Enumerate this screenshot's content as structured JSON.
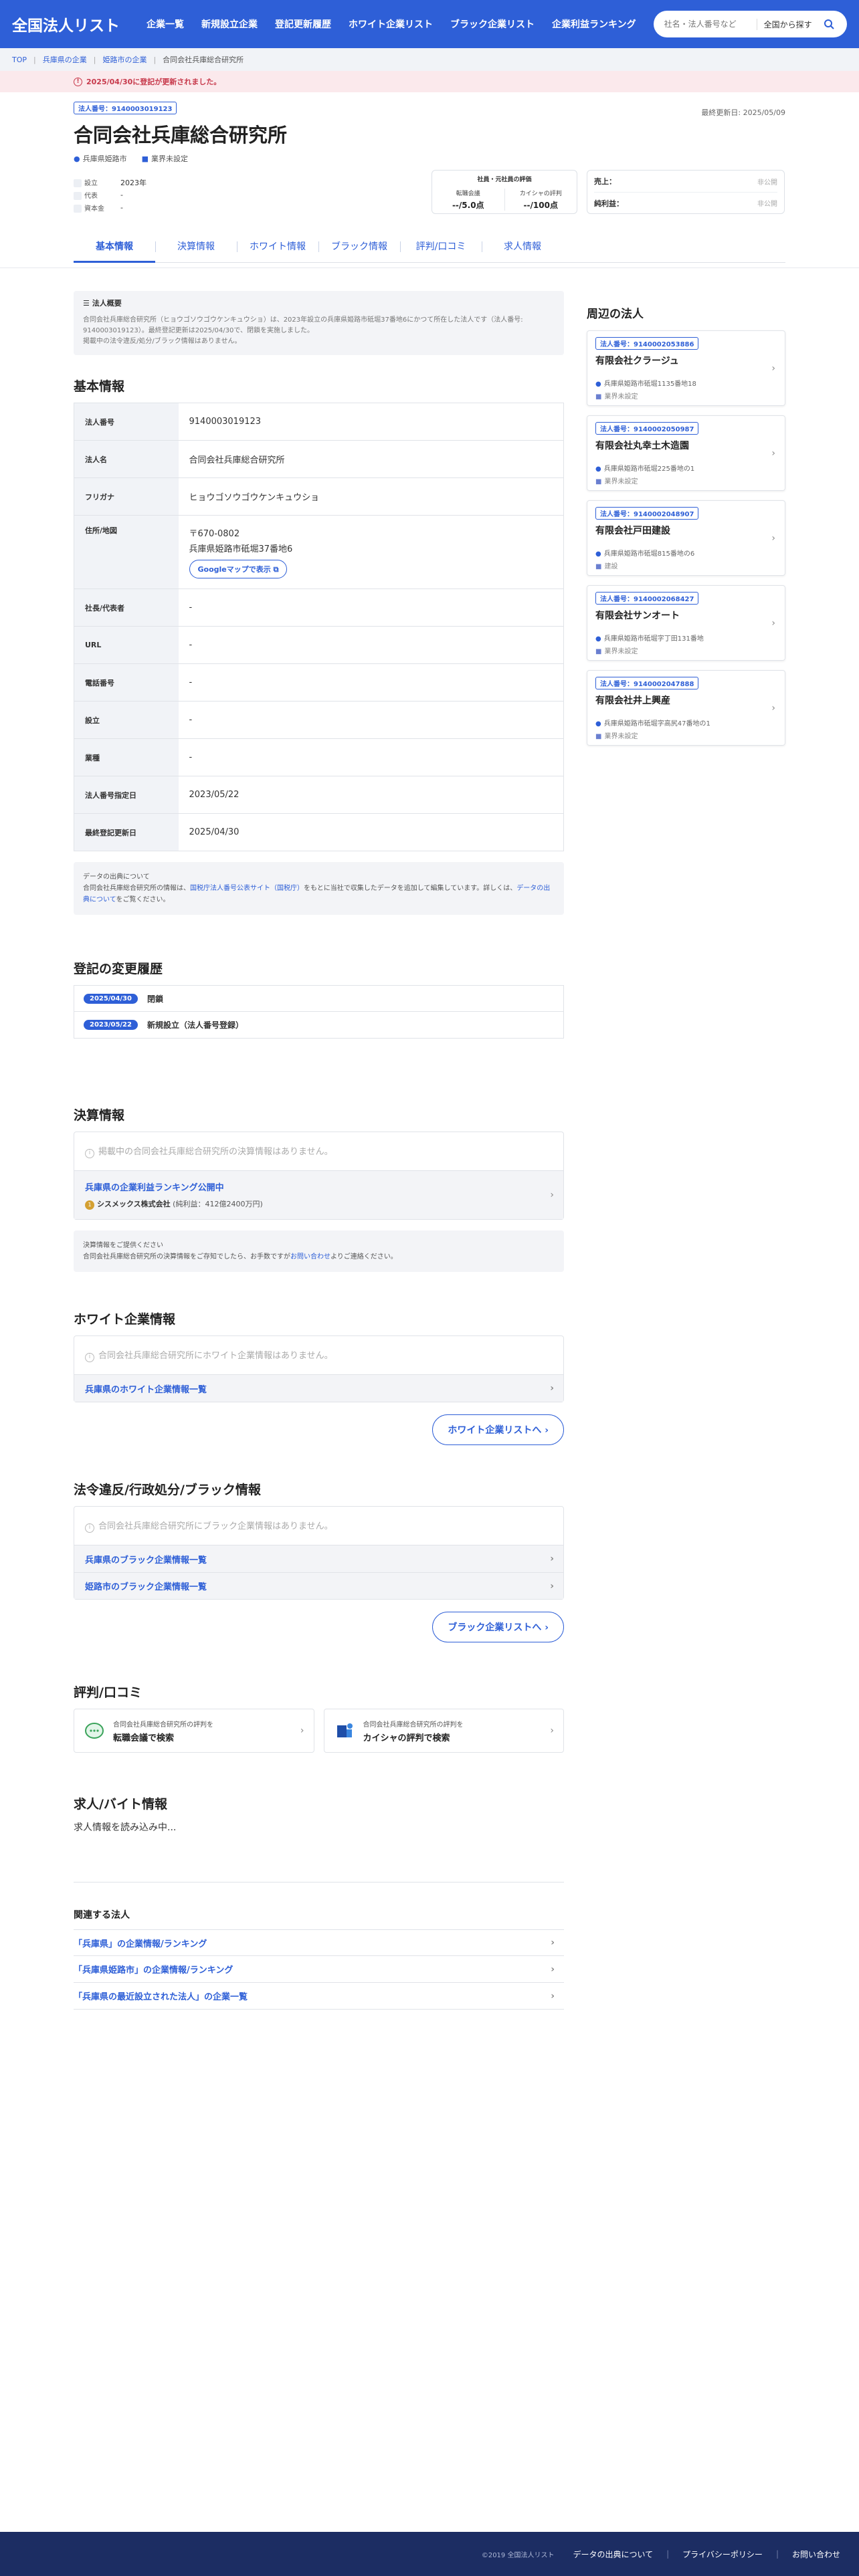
{
  "header": {
    "logo": "全国法人リスト",
    "nav": [
      "企業一覧",
      "新規設立企業",
      "登記更新履歴",
      "ホワイト企業リスト",
      "ブラック企業リスト",
      "企業利益ランキング"
    ],
    "search_placeholder": "社名・法人番号など",
    "search_scope": "全国から探す"
  },
  "breadcrumb": {
    "items": [
      "TOP",
      "兵庫県の企業",
      "姫路市の企業"
    ],
    "current": "合同会社兵庫総合研究所"
  },
  "alert": "2025/04/30に登記が更新されました。",
  "company": {
    "corp_number_badge": "法人番号：9140003019123",
    "name": "合同会社兵庫総合研究所",
    "updated": "最終更新日: 2025/05/09",
    "location": "兵庫県姫路市",
    "industry": "業界未設定"
  },
  "props": {
    "founded_label": "設立",
    "founded_value": "2023年",
    "rep_label": "代表",
    "rep_value": "-",
    "capital_label": "資本金",
    "capital_value": "-"
  },
  "rating": {
    "title": "社員・元社員の評価",
    "col1_label": "転職会議",
    "col1_value": "--/5.0点",
    "col2_label": "カイシャの評判",
    "col2_value": "--/100点"
  },
  "finance": {
    "sales_label": "売上：",
    "sales_value": "非公開",
    "profit_label": "純利益：",
    "profit_value": "非公開"
  },
  "tabs": [
    "基本情報",
    "決算情報",
    "ホワイト情報",
    "ブラック情報",
    "評判/口コミ",
    "求人情報"
  ],
  "overview": {
    "head": "法人概要",
    "text1": "合同会社兵庫総合研究所（ヒョウゴソウゴウケンキュウショ）は、2023年設立の兵庫県姫路市砥堀37番地6にかつて所在した法人です（法人番号: 9140003019123）。最終登記更新は2025/04/30で、閉鎖を実施しました。",
    "text2": "掲載中の法令違反/処分/ブラック情報はありません。"
  },
  "basic": {
    "heading": "基本情報",
    "rows": [
      {
        "label": "法人番号",
        "value": "9140003019123"
      },
      {
        "label": "法人名",
        "value": "合同会社兵庫総合研究所"
      },
      {
        "label": "フリガナ",
        "value": "ヒョウゴソウゴウケンキュウショ"
      }
    ],
    "addr_label": "住所/地図",
    "postal": "〒670-0802",
    "address": "兵庫県姫路市砥堀37番地6",
    "map_button": "Googleマップで表示",
    "rows2": [
      {
        "label": "社長/代表者",
        "value": "-"
      },
      {
        "label": "URL",
        "value": "-"
      },
      {
        "label": "電話番号",
        "value": "-"
      },
      {
        "label": "設立",
        "value": "-"
      },
      {
        "label": "業種",
        "value": "-"
      },
      {
        "label": "法人番号指定日",
        "value": "2023/05/22"
      },
      {
        "label": "最終登記更新日",
        "value": "2025/04/30"
      }
    ]
  },
  "source": {
    "title": "データの出典について",
    "text_a": "合同会社兵庫総合研究所の情報は、",
    "link1": "国税庁法人番号公表サイト（国税庁）",
    "text_b": "をもとに当社で収集したデータを追加して編集しています。詳しくは、",
    "link2": "データの出典について",
    "text_c": "をご覧ください。"
  },
  "history": {
    "heading": "登記の変更履歴",
    "items": [
      {
        "date": "2025/04/30",
        "label": "閉鎖"
      },
      {
        "date": "2023/05/22",
        "label": "新規設立（法人番号登録）"
      }
    ]
  },
  "settlement": {
    "heading": "決算情報",
    "empty": "掲載中の合同会社兵庫総合研究所の決算情報はありません。",
    "rank_link": "兵庫県の企業利益ランキング公開中",
    "rank_company": "シスメックス株式会社",
    "rank_profit": "(純利益：412億2400万円)",
    "note_title": "決算情報をご提供ください",
    "note_a": "合同会社兵庫総合研究所の決算情報をご存知でしたら、お手数ですが",
    "note_link": "お問い合わせ",
    "note_b": "よりご連絡ください。"
  },
  "white": {
    "heading": "ホワイト企業情報",
    "empty": "合同会社兵庫総合研究所にホワイト企業情報はありません。",
    "link": "兵庫県のホワイト企業情報一覧",
    "button": "ホワイト企業リストへ ›"
  },
  "black": {
    "heading": "法令違反/行政処分/ブラック情報",
    "empty": "合同会社兵庫総合研究所にブラック企業情報はありません。",
    "link1": "兵庫県のブラック企業情報一覧",
    "link2": "姫路市のブラック企業情報一覧",
    "button": "ブラック企業リストへ ›"
  },
  "review": {
    "heading": "評判/口コミ",
    "card1_small": "合同会社兵庫総合研究所の評判を",
    "card1_big": "転職会議で検索",
    "card2_small": "合同会社兵庫総合研究所の評判を",
    "card2_big": "カイシャの評判で検索"
  },
  "jobs": {
    "heading": "求人/バイト情報",
    "loading": "求人情報を読み込み中..."
  },
  "related": {
    "heading": "関連する法人",
    "items": [
      "「兵庫県」の企業情報/ランキング",
      "「兵庫県姫路市」の企業情報/ランキング",
      "「兵庫県の最近設立された法人」の企業一覧"
    ]
  },
  "nearby": {
    "heading": "周辺の法人",
    "items": [
      {
        "badge": "法人番号：9140002053886",
        "name": "有限会社クラージュ",
        "addr": "兵庫県姫路市砥堀1135番地18",
        "ind": "業界未設定"
      },
      {
        "badge": "法人番号：9140002050987",
        "name": "有限会社丸幸土木造園",
        "addr": "兵庫県姫路市砥堀225番地の1",
        "ind": "業界未設定"
      },
      {
        "badge": "法人番号：9140002048907",
        "name": "有限会社戸田建設",
        "addr": "兵庫県姫路市砥堀815番地の6",
        "ind": "建設"
      },
      {
        "badge": "法人番号：9140002068427",
        "name": "有限会社サンオート",
        "addr": "兵庫県姫路市砥堀字丁田131番地",
        "ind": "業界未設定"
      },
      {
        "badge": "法人番号：9140002047888",
        "name": "有限会社井上興産",
        "addr": "兵庫県姫路市砥堀字高尻47番地の1",
        "ind": "業界未設定"
      }
    ]
  },
  "footer": {
    "copy": "©2019 全国法人リスト",
    "link1": "データの出典について",
    "link2": "プライバシーポリシー",
    "link3": "お問い合わせ"
  },
  "colors": {
    "brand": "#2e5fd7",
    "footer": "#1c2d63",
    "alert_bg": "#fbe9ec",
    "alert_text": "#c7394b"
  }
}
